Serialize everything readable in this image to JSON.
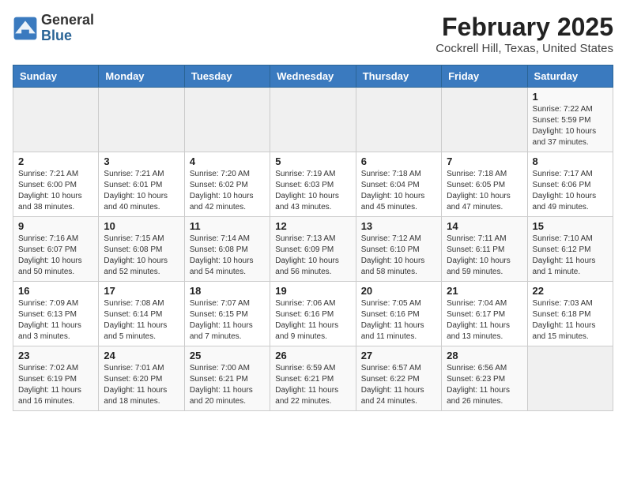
{
  "header": {
    "logo_general": "General",
    "logo_blue": "Blue",
    "title": "February 2025",
    "subtitle": "Cockrell Hill, Texas, United States"
  },
  "weekdays": [
    "Sunday",
    "Monday",
    "Tuesday",
    "Wednesday",
    "Thursday",
    "Friday",
    "Saturday"
  ],
  "weeks": [
    [
      {
        "day": "",
        "info": ""
      },
      {
        "day": "",
        "info": ""
      },
      {
        "day": "",
        "info": ""
      },
      {
        "day": "",
        "info": ""
      },
      {
        "day": "",
        "info": ""
      },
      {
        "day": "",
        "info": ""
      },
      {
        "day": "1",
        "info": "Sunrise: 7:22 AM\nSunset: 5:59 PM\nDaylight: 10 hours and 37 minutes."
      }
    ],
    [
      {
        "day": "2",
        "info": "Sunrise: 7:21 AM\nSunset: 6:00 PM\nDaylight: 10 hours and 38 minutes."
      },
      {
        "day": "3",
        "info": "Sunrise: 7:21 AM\nSunset: 6:01 PM\nDaylight: 10 hours and 40 minutes."
      },
      {
        "day": "4",
        "info": "Sunrise: 7:20 AM\nSunset: 6:02 PM\nDaylight: 10 hours and 42 minutes."
      },
      {
        "day": "5",
        "info": "Sunrise: 7:19 AM\nSunset: 6:03 PM\nDaylight: 10 hours and 43 minutes."
      },
      {
        "day": "6",
        "info": "Sunrise: 7:18 AM\nSunset: 6:04 PM\nDaylight: 10 hours and 45 minutes."
      },
      {
        "day": "7",
        "info": "Sunrise: 7:18 AM\nSunset: 6:05 PM\nDaylight: 10 hours and 47 minutes."
      },
      {
        "day": "8",
        "info": "Sunrise: 7:17 AM\nSunset: 6:06 PM\nDaylight: 10 hours and 49 minutes."
      }
    ],
    [
      {
        "day": "9",
        "info": "Sunrise: 7:16 AM\nSunset: 6:07 PM\nDaylight: 10 hours and 50 minutes."
      },
      {
        "day": "10",
        "info": "Sunrise: 7:15 AM\nSunset: 6:08 PM\nDaylight: 10 hours and 52 minutes."
      },
      {
        "day": "11",
        "info": "Sunrise: 7:14 AM\nSunset: 6:08 PM\nDaylight: 10 hours and 54 minutes."
      },
      {
        "day": "12",
        "info": "Sunrise: 7:13 AM\nSunset: 6:09 PM\nDaylight: 10 hours and 56 minutes."
      },
      {
        "day": "13",
        "info": "Sunrise: 7:12 AM\nSunset: 6:10 PM\nDaylight: 10 hours and 58 minutes."
      },
      {
        "day": "14",
        "info": "Sunrise: 7:11 AM\nSunset: 6:11 PM\nDaylight: 10 hours and 59 minutes."
      },
      {
        "day": "15",
        "info": "Sunrise: 7:10 AM\nSunset: 6:12 PM\nDaylight: 11 hours and 1 minute."
      }
    ],
    [
      {
        "day": "16",
        "info": "Sunrise: 7:09 AM\nSunset: 6:13 PM\nDaylight: 11 hours and 3 minutes."
      },
      {
        "day": "17",
        "info": "Sunrise: 7:08 AM\nSunset: 6:14 PM\nDaylight: 11 hours and 5 minutes."
      },
      {
        "day": "18",
        "info": "Sunrise: 7:07 AM\nSunset: 6:15 PM\nDaylight: 11 hours and 7 minutes."
      },
      {
        "day": "19",
        "info": "Sunrise: 7:06 AM\nSunset: 6:16 PM\nDaylight: 11 hours and 9 minutes."
      },
      {
        "day": "20",
        "info": "Sunrise: 7:05 AM\nSunset: 6:16 PM\nDaylight: 11 hours and 11 minutes."
      },
      {
        "day": "21",
        "info": "Sunrise: 7:04 AM\nSunset: 6:17 PM\nDaylight: 11 hours and 13 minutes."
      },
      {
        "day": "22",
        "info": "Sunrise: 7:03 AM\nSunset: 6:18 PM\nDaylight: 11 hours and 15 minutes."
      }
    ],
    [
      {
        "day": "23",
        "info": "Sunrise: 7:02 AM\nSunset: 6:19 PM\nDaylight: 11 hours and 16 minutes."
      },
      {
        "day": "24",
        "info": "Sunrise: 7:01 AM\nSunset: 6:20 PM\nDaylight: 11 hours and 18 minutes."
      },
      {
        "day": "25",
        "info": "Sunrise: 7:00 AM\nSunset: 6:21 PM\nDaylight: 11 hours and 20 minutes."
      },
      {
        "day": "26",
        "info": "Sunrise: 6:59 AM\nSunset: 6:21 PM\nDaylight: 11 hours and 22 minutes."
      },
      {
        "day": "27",
        "info": "Sunrise: 6:57 AM\nSunset: 6:22 PM\nDaylight: 11 hours and 24 minutes."
      },
      {
        "day": "28",
        "info": "Sunrise: 6:56 AM\nSunset: 6:23 PM\nDaylight: 11 hours and 26 minutes."
      },
      {
        "day": "",
        "info": ""
      }
    ]
  ]
}
